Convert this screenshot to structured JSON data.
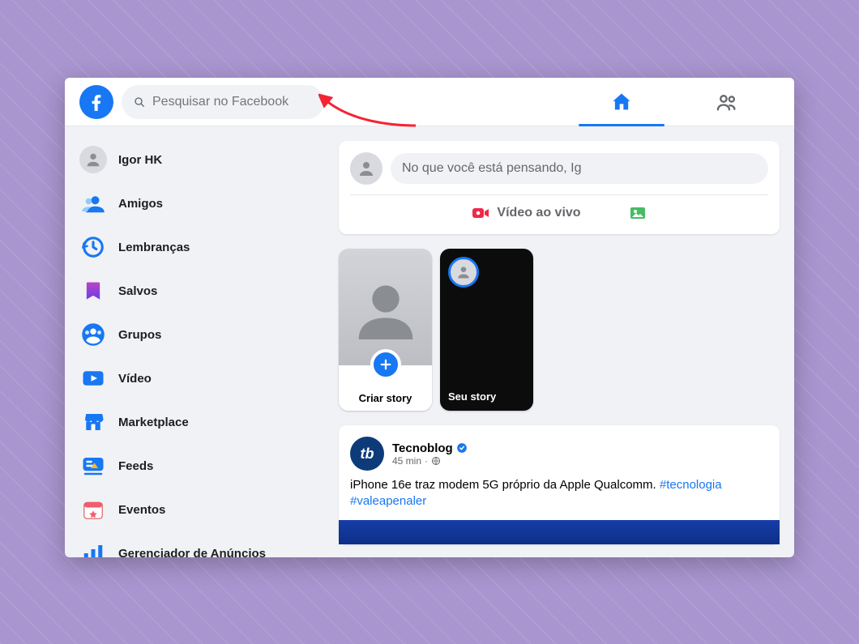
{
  "header": {
    "search_placeholder": "Pesquisar no Facebook"
  },
  "topnav": {
    "home_active": true
  },
  "sidebar": {
    "items": [
      {
        "key": "profile",
        "label": "Igor HK"
      },
      {
        "key": "friends",
        "label": "Amigos"
      },
      {
        "key": "memories",
        "label": "Lembranças"
      },
      {
        "key": "saved",
        "label": "Salvos"
      },
      {
        "key": "groups",
        "label": "Grupos"
      },
      {
        "key": "video",
        "label": "Vídeo"
      },
      {
        "key": "marketplace",
        "label": "Marketplace"
      },
      {
        "key": "feeds",
        "label": "Feeds"
      },
      {
        "key": "events",
        "label": "Eventos"
      },
      {
        "key": "ads",
        "label": "Gerenciador de Anúncios"
      }
    ]
  },
  "composer": {
    "placeholder": "No que você está pensando, Ig",
    "live_video_label": "Vídeo ao vivo"
  },
  "stories": {
    "create_label": "Criar story",
    "other_label": "Seu story"
  },
  "feed": {
    "item": {
      "page_name": "Tecnoblog",
      "time": "45 min",
      "body_text": "iPhone 16e traz modem 5G próprio da Apple Qualcomm. ",
      "hashtags": "#tecnologia #valeapenaler"
    }
  },
  "colors": {
    "fb_blue": "#1877f2",
    "live_red": "#f02849"
  }
}
